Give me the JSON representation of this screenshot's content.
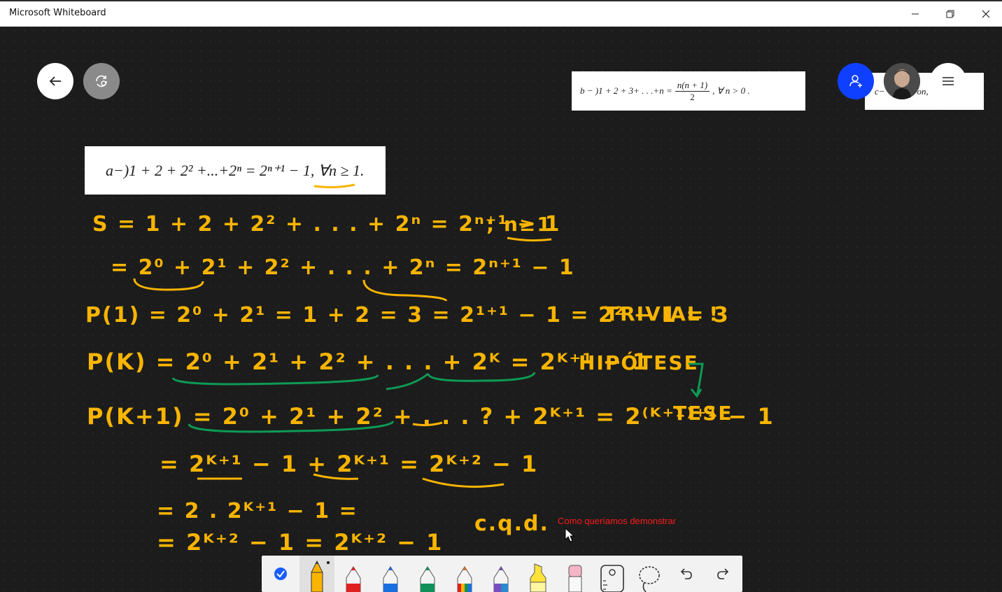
{
  "window": {
    "title": "Microsoft Whiteboard",
    "controls": [
      "minimize",
      "restore",
      "close"
    ]
  },
  "top_left": {
    "back_icon": "arrow-left-icon",
    "sync_icon": "sync-icon"
  },
  "top_right": {
    "invite_icon": "add-person-icon",
    "avatar": "user-avatar",
    "menu_icon": "hamburger-icon",
    "accent_color": "#1040ff"
  },
  "cards": {
    "b": {
      "prefix": "b − )1 + 2 + 3+ . . .+n =",
      "frac_num": "n(n + 1)",
      "frac_den": "2",
      "suffix": ", ∀ n > 0 ."
    },
    "c_visible": "c−",
    "c_visible_tail": "on,",
    "a": {
      "text": "a−)1 + 2 + 2² +...+2ⁿ = 2ⁿ⁺¹ − 1, ∀n ≥ 1."
    }
  },
  "ink": {
    "line1": "S = 1 + 2 + 2² + . . . + 2ⁿ = 2ⁿ⁺¹ − 1",
    "line1_cond": "; n≥1",
    "line2": "= 2⁰ + 2¹ + 2² + . . . + 2ⁿ = 2ⁿ⁺¹ − 1",
    "line3": "P(1) = 2⁰ + 2¹ = 1 + 2 = 3 = 2¹⁺¹ − 1 = 2² − 1 = 3",
    "line3_tag": "TRIVIAL !",
    "line4": "P(K) = 2⁰ + 2¹ + 2² + . . . + 2ᴷ = 2ᴷ⁺¹ − 1",
    "line4_tag": "HIPÓTESE",
    "line5": "P(K+1) = 2⁰ + 2¹ + 2² + . . . ? + 2ᴷ⁺¹ = 2⁽ᴷ⁺¹⁾⁺¹ − 1",
    "line5_tag": "TESE",
    "line6": "= 2ᴷ⁺¹ − 1 + 2ᴷ⁺¹  =  2ᴷ⁺² − 1",
    "line7": "= 2 . 2ᴷ⁺¹ − 1 =",
    "line8": "= 2ᴷ⁺² − 1  =  2ᴷ⁺² − 1",
    "cqd": "c.q.d.",
    "ink_color": "#f8b400",
    "green_color": "#0e9a54"
  },
  "note": "Como queríamos demonstrar",
  "toolbar": {
    "tools": [
      {
        "name": "select-tool",
        "icon": "checkmark-icon",
        "color": "#1a5cff"
      },
      {
        "name": "pencil-tool",
        "icon": "pencil-icon",
        "color": "#f8b400",
        "selected": true
      },
      {
        "name": "pen-red",
        "icon": "pen-icon",
        "color": "#e02020"
      },
      {
        "name": "pen-blue",
        "icon": "pen-icon",
        "color": "#1a6fe0"
      },
      {
        "name": "pen-green",
        "icon": "pen-icon",
        "color": "#11915a"
      },
      {
        "name": "pen-rainbow",
        "icon": "pen-icon",
        "color": "#e0702a"
      },
      {
        "name": "pen-galaxy",
        "icon": "pen-icon",
        "color": "#7a4cc0"
      },
      {
        "name": "highlighter",
        "icon": "highlighter-icon",
        "color": "#ffe23a"
      },
      {
        "name": "eraser",
        "icon": "eraser-icon",
        "color": "#f4b6c6"
      },
      {
        "name": "ruler",
        "icon": "ruler-icon",
        "color": "#333333"
      },
      {
        "name": "lasso",
        "icon": "lasso-icon",
        "color": "#333333"
      },
      {
        "name": "undo",
        "icon": "undo-icon",
        "color": "#333333"
      },
      {
        "name": "redo",
        "icon": "redo-icon",
        "color": "#333333"
      }
    ]
  }
}
